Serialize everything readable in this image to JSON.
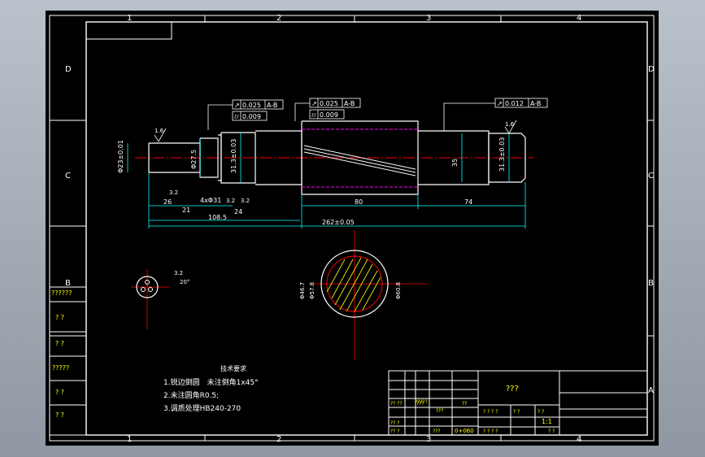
{
  "zones": {
    "columns": [
      "1",
      "2",
      "3",
      "4"
    ],
    "rows": [
      "D",
      "C",
      "B",
      "A"
    ]
  },
  "tolerance_frames": [
    {
      "symbol": "↗",
      "value": "0.025",
      "datum": "A-B"
    },
    {
      "symbol": "⌭",
      "value": "0.009"
    },
    {
      "symbol": "↗",
      "value": "0.025",
      "datum": "A-B"
    },
    {
      "symbol": "⌭",
      "value": "0.009"
    },
    {
      "symbol": "↗",
      "value": "0.012",
      "datum": "A-B"
    }
  ],
  "roughness": [
    "1.6",
    "1.6",
    "3.2",
    "3.2",
    "3.2",
    "3.2"
  ],
  "dimensions": {
    "d1": "Φ23±0.01",
    "d2": "Φ27.5",
    "d3": "31.3±0.03",
    "d4": "35",
    "d5": "31.3±0.03",
    "l1": "26",
    "l2": "21",
    "l3": "4xΦ31",
    "l4": "24",
    "l5": "108.5",
    "l6": "80",
    "l7": "74",
    "l8": "262±0.05",
    "sec1": "Φ46.7",
    "sec2": "Φ57.8",
    "sec3": "Φ60.8",
    "side_angle": "20°"
  },
  "tech_req": {
    "title": "技术要求",
    "lines": [
      "1.锐边倒圆　未注倒角1x45°",
      "2.未注圆角R0.5;",
      "3.调质处理HB240-270"
    ]
  },
  "title_block": {
    "name": "???",
    "scale": "1:1",
    "material": "0+060",
    "cells": [
      "?? ??",
      "???",
      "?????",
      "??",
      "???",
      "? ? ? ?",
      "? ? ? ?",
      "?? ?",
      "?? ?",
      "???",
      "? ?",
      "? ?",
      "? ?"
    ]
  },
  "side_labels": [
    "??????",
    "?  ?",
    "?  ?",
    "?????",
    "?  ?",
    "?  ?"
  ]
}
